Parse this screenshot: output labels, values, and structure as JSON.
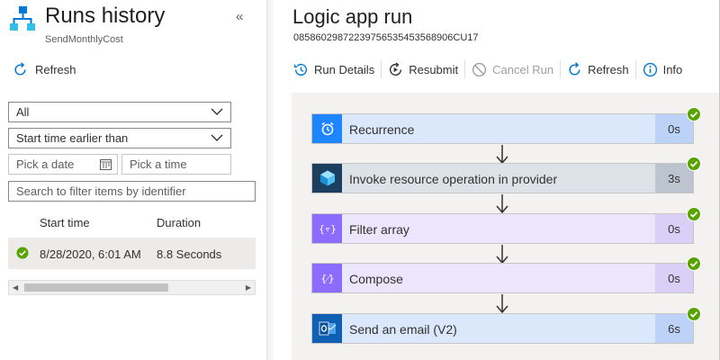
{
  "left_pane": {
    "title": "Runs history",
    "subtitle": "SendMonthlyCost",
    "collapse_glyph": "«",
    "refresh_label": "Refresh",
    "status_filter": {
      "selected": "All"
    },
    "time_filter": {
      "selected": "Start time earlier than"
    },
    "date_placeholder": "Pick a date",
    "time_placeholder": "Pick a time",
    "search_placeholder": "Search to filter items by identifier",
    "columns": [
      "Start time",
      "Duration"
    ],
    "runs": [
      {
        "status": "succeeded",
        "start_time": "8/28/2020, 6:01 AM",
        "duration": "8.8 Seconds"
      }
    ]
  },
  "right_pane": {
    "title": "Logic app run",
    "run_id": "08586029872239756535453568906CU17",
    "toolbar": {
      "run_details": "Run Details",
      "resubmit": "Resubmit",
      "cancel_run": "Cancel Run",
      "refresh": "Refresh",
      "info": "Info"
    },
    "steps": [
      {
        "name": "Recurrence",
        "duration": "0s",
        "icon": "alarm-clock-icon",
        "icon_color": "#1f85ff",
        "body_color": "#dbe7fb",
        "dur_color": "#bcd3f7",
        "status": "succeeded"
      },
      {
        "name": "Invoke resource operation in provider",
        "duration": "3s",
        "icon": "azure-resource-cube-icon",
        "icon_color": "#1c3f60",
        "body_color": "#dde2e8",
        "dur_color": "#bcc5cf",
        "status": "succeeded"
      },
      {
        "name": "Filter array",
        "duration": "0s",
        "icon": "filter-array-icon",
        "icon_color": "#8c6cff",
        "body_color": "#ebe6fb",
        "dur_color": "#d9cff7",
        "status": "succeeded"
      },
      {
        "name": "Compose",
        "duration": "0s",
        "icon": "compose-icon",
        "icon_color": "#8c6cff",
        "body_color": "#ebe6fb",
        "dur_color": "#d9cff7",
        "status": "succeeded"
      },
      {
        "name": "Send an email (V2)",
        "duration": "6s",
        "icon": "outlook-mail-icon",
        "icon_color": "#0f5fb5",
        "body_color": "#dbe7fb",
        "dur_color": "#bcd3f7",
        "status": "succeeded"
      }
    ]
  },
  "colors": {
    "success_green": "#57a300",
    "accent_blue": "#0078d4"
  }
}
